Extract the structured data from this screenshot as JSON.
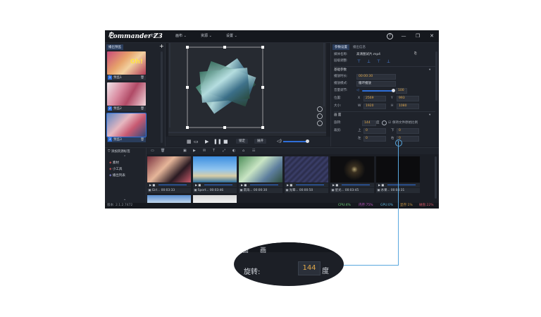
{
  "app": {
    "logo": "ommander Z3",
    "menus": [
      "文件 ⌄",
      "画布 ⌄",
      "资源 ⌄",
      "设置 ⌄"
    ],
    "window_buttons": [
      "?",
      "—",
      "❐",
      "✕"
    ]
  },
  "left_panel": {
    "tab": "播出预监",
    "plus": "+",
    "items": [
      {
        "num": "1",
        "label": "预监1"
      },
      {
        "num": "2",
        "label": "预监2"
      },
      {
        "num": "3",
        "label": "预监3"
      }
    ]
  },
  "preview": {
    "controls": {
      "lock": "锁定",
      "expand": "展开"
    }
  },
  "right_panel": {
    "tabs": [
      "参数设置",
      "播出信息"
    ],
    "media_name_label": "媒体名称:",
    "media_name": "高清图试片.mp4",
    "align_label": "层级调整:",
    "basic_section": "基础参数",
    "play_time_label": "播放时长:",
    "play_time": "00:00:30",
    "play_mode_label": "播放模式:",
    "play_mode": "循环播放",
    "volume_label": "音量调节:",
    "volume": "100",
    "position_label": "位置:",
    "pos_x_label": "X",
    "pos_x": "2569",
    "pos_y_label": "Y",
    "pos_y": "993",
    "size_label": "大小:",
    "size_w_label": "W",
    "size_w": "1920",
    "size_h_label": "H",
    "size_h": "1080",
    "picture_section": "画    面",
    "rotate_label": "旋转:",
    "rotate_value": "144",
    "rotate_unit": "度",
    "keep_ratio": "保持文件原始比例",
    "crop_label": "裁剪:",
    "crop_top": "上",
    "crop_bottom": "下",
    "crop_left": "左",
    "crop_right": "右",
    "crop_vals": [
      "0",
      "0",
      "0",
      "0"
    ]
  },
  "resources": {
    "add_button": "添加资源标签",
    "items": [
      "素材",
      "小工具",
      "播出列表"
    ]
  },
  "clips": [
    {
      "name": "Girl...",
      "time": "00:03:33"
    },
    {
      "name": "Sport...",
      "time": "00:03:46"
    },
    {
      "name": "南海...",
      "time": "00:00:30"
    },
    {
      "name": "光晕...",
      "time": "00:00:50"
    },
    {
      "name": "星光...",
      "time": "00:03:45"
    },
    {
      "name": "水果...",
      "time": "00:04:31"
    }
  ],
  "status": {
    "version": "版本: 2.1.2.7472",
    "cpu": "CPU:4%",
    "mem": "内存:75%",
    "gpu": "GPU:0%",
    "vram": "显存:1%",
    "disk": "磁盘:22%"
  },
  "callout": {
    "partial_top_labels": [
      "面",
      "画"
    ],
    "rotate_label": "旋转:",
    "rotate_value": "144",
    "rotate_unit": "度"
  },
  "colors": {
    "accent": "#2f6fd8",
    "value_orange": "#e0a84a",
    "callout_line": "#59a7de"
  }
}
